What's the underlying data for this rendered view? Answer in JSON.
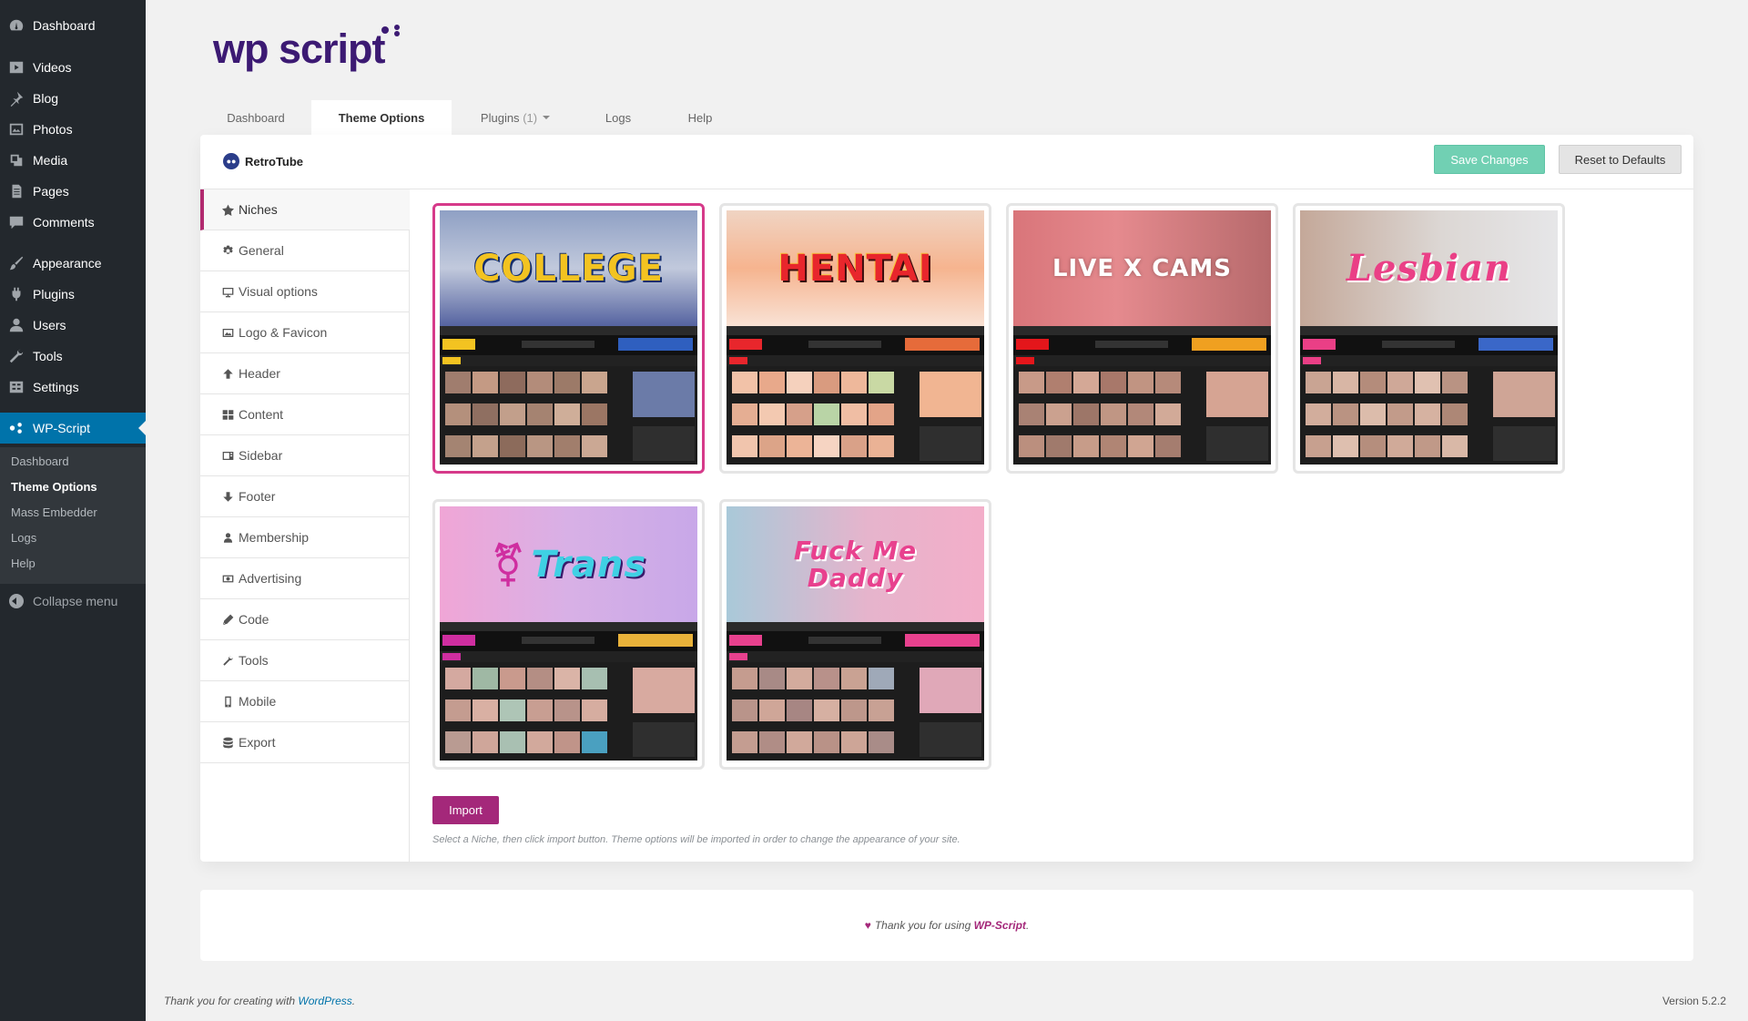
{
  "admin_menu": {
    "items": [
      {
        "label": "Dashboard",
        "icon": "dashboard-icon"
      },
      {
        "label": "Videos",
        "icon": "video-icon"
      },
      {
        "label": "Blog",
        "icon": "pin-icon"
      },
      {
        "label": "Photos",
        "icon": "photo-icon"
      },
      {
        "label": "Media",
        "icon": "media-icon"
      },
      {
        "label": "Pages",
        "icon": "page-icon"
      },
      {
        "label": "Comments",
        "icon": "comment-icon"
      },
      {
        "label": "Appearance",
        "icon": "brush-icon"
      },
      {
        "label": "Plugins",
        "icon": "plugin-icon"
      },
      {
        "label": "Users",
        "icon": "user-icon"
      },
      {
        "label": "Tools",
        "icon": "wrench-icon"
      },
      {
        "label": "Settings",
        "icon": "settings-icon"
      },
      {
        "label": "WP-Script",
        "icon": "wpscript-icon"
      }
    ],
    "submenu": [
      "Dashboard",
      "Theme Options",
      "Mass Embedder",
      "Logs",
      "Help"
    ],
    "collapse_label": "Collapse menu"
  },
  "brand": {
    "logo_text": "wp script",
    "accent": "#3c1a73"
  },
  "tabs": [
    {
      "label": "Dashboard"
    },
    {
      "label": "Theme Options"
    },
    {
      "label": "Plugins",
      "count": "(1)"
    },
    {
      "label": "Logs"
    },
    {
      "label": "Help"
    }
  ],
  "panel": {
    "theme_name": "RetroTube",
    "save_label": "Save Changes",
    "reset_label": "Reset to Defaults",
    "sections": [
      {
        "label": "Niches",
        "icon": "star-icon"
      },
      {
        "label": "General",
        "icon": "gear-icon"
      },
      {
        "label": "Visual options",
        "icon": "monitor-icon"
      },
      {
        "label": "Logo & Favicon",
        "icon": "image-icon"
      },
      {
        "label": "Header",
        "icon": "arrow-up-icon"
      },
      {
        "label": "Content",
        "icon": "grid-icon"
      },
      {
        "label": "Sidebar",
        "icon": "sidebar-icon"
      },
      {
        "label": "Footer",
        "icon": "arrow-down-icon"
      },
      {
        "label": "Membership",
        "icon": "user-icon"
      },
      {
        "label": "Advertising",
        "icon": "ad-icon"
      },
      {
        "label": "Code",
        "icon": "pencil-icon"
      },
      {
        "label": "Tools",
        "icon": "wrench-icon"
      },
      {
        "label": "Mobile",
        "icon": "mobile-icon"
      },
      {
        "label": "Export",
        "icon": "database-icon"
      }
    ],
    "niches": [
      {
        "label": "COLLEGE",
        "selected": true
      },
      {
        "label": "HENTAI",
        "selected": false
      },
      {
        "label": "LIVE X CAMS",
        "selected": false
      },
      {
        "label": "Lesbian",
        "selected": false
      },
      {
        "label": "Trans",
        "selected": false
      },
      {
        "label": "Fuck Me Daddy",
        "selected": false
      }
    ],
    "import_label": "Import",
    "help_text": "Select a Niche, then click import button. Theme options will be imported in order to change the appearance of your site."
  },
  "footer_card": {
    "text": "Thank you for using",
    "brand": "WP-Script",
    "end": "."
  },
  "wp_footer": {
    "text": "Thank you for creating with",
    "link": "WordPress",
    "end": ".",
    "version": "Version 5.2.2"
  }
}
